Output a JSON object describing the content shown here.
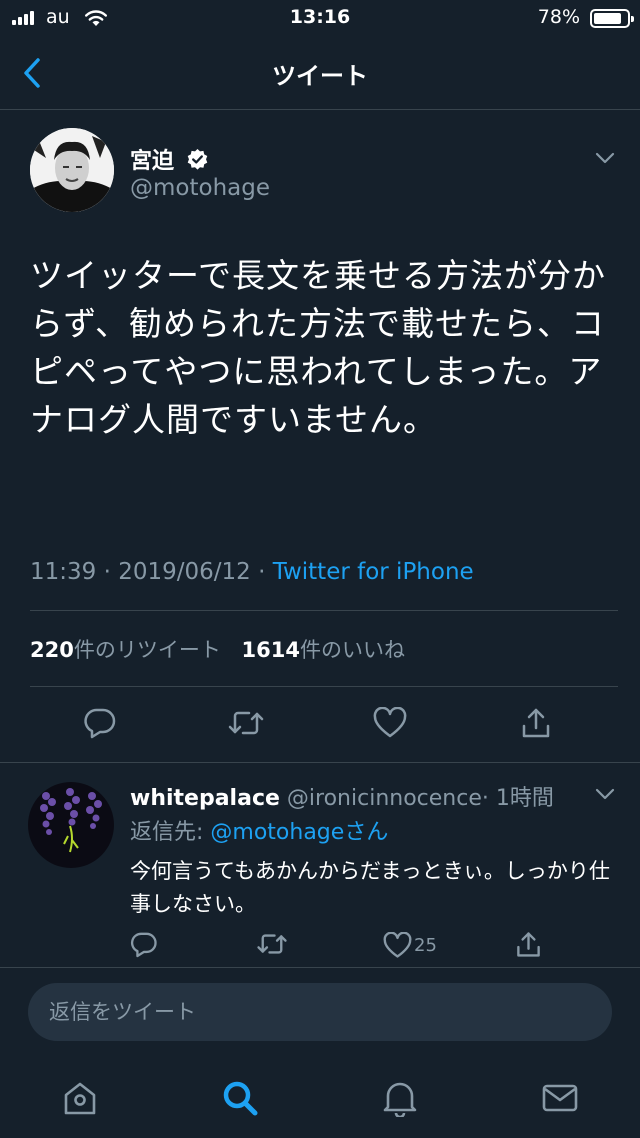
{
  "status_bar": {
    "carrier": "au",
    "time": "13:16",
    "battery": "78%",
    "battery_level": 0.78
  },
  "nav": {
    "title": "ツイート",
    "back_icon": "chevron-left-icon"
  },
  "tweet": {
    "name": "宮迫",
    "verified_icon": "verified-badge-icon",
    "handle": "@motohage",
    "text": "ツイッターで長文を乗せる方法が分からず、勧められた方法で載せたら、コピペってやつに思われてしまった。アナログ人間ですいません。",
    "time": "11:39 · 2019/06/12 · ",
    "source": "Twitter for iPhone",
    "retweets_count": "220",
    "retweets_label": "件のリツイート",
    "likes_count": "1614",
    "likes_label": "件のいいね"
  },
  "reply": {
    "name": "whitepalace",
    "handle": "@ironicinnocence",
    "time": "· 1時間",
    "reply_to_label": "返信先: ",
    "reply_to_handle": "@motohage",
    "reply_to_suffix": "さん",
    "text": "今何言うてもあかんからだまっときぃ。しっかり仕事しなさい。",
    "like_count": "25"
  },
  "compose": {
    "placeholder": "返信をツイート"
  },
  "tab_bar": {
    "items": [
      "home-icon",
      "search-icon",
      "notifications-icon",
      "messages-icon"
    ],
    "active": "search-icon"
  },
  "colors": {
    "background": "#15202b",
    "accent": "#1da1f2",
    "muted": "#8899a6",
    "divider": "#38444d"
  }
}
